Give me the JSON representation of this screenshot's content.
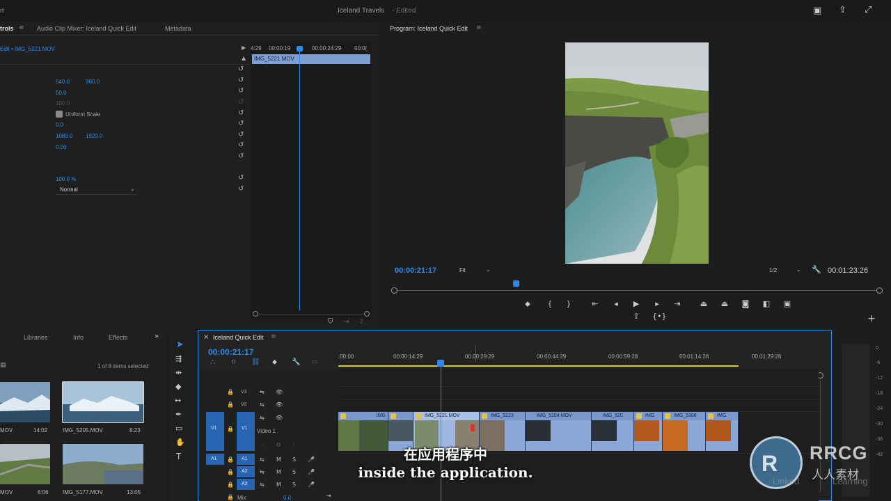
{
  "window": {
    "title": "Iceland Travels",
    "status": "- Edited",
    "left_fragment": "rt"
  },
  "effect_controls": {
    "tabs": [
      "trols",
      "Audio Clip Mixer: Iceland Quick Edit",
      "Metadata"
    ],
    "clip_path": "Edit • IMG_5221.MOV",
    "values": {
      "position_x": "540.0",
      "position_y": "960.0",
      "scale": "50.0",
      "scale_width": "100.0",
      "uniform_scale": "Uniform Scale",
      "rotation": "0.0",
      "anchor_x": "1080.0",
      "anchor_y": "1920.0",
      "anti_flicker": "0.00",
      "opacity": "100.0 %",
      "blend_mode": "Normal"
    },
    "mini_ruler": [
      "4:29",
      "00:00:19",
      "00:00:24:29",
      "00:0("
    ],
    "mini_clip": "IMG_5221.MOV"
  },
  "program_monitor": {
    "title": "Program: Iceland Quick Edit",
    "timecode": "00:00:21:17",
    "fit": "Fit",
    "resolution": "1/2",
    "duration": "00:01:23:26"
  },
  "project_panel": {
    "tabs": [
      "Libraries",
      "Info",
      "Effects"
    ],
    "selection": "1 of 8 items selected",
    "items": [
      {
        "name": "MOV",
        "duration": "14:02"
      },
      {
        "name": "IMG_5205.MOV",
        "duration": "8:23"
      },
      {
        "name": "MOV",
        "duration": "6:06"
      },
      {
        "name": "IMG_5177.MOV",
        "duration": "13:05"
      }
    ]
  },
  "timeline": {
    "title": "Iceland Quick Edit",
    "timecode": "00:00:21:17",
    "ruler": [
      ":00:00",
      "00:00:14:29",
      "00:00:29:29",
      "00:00:44:29",
      "00:00:59:28",
      "00:01:14:28",
      "00:01:29:28"
    ],
    "tracks": {
      "v3": "V3",
      "v2": "V2",
      "v1": "V1",
      "v1_src": "V1",
      "video1": "Video 1",
      "a1": "A1",
      "a1_src": "A1",
      "a2": "A2",
      "a3": "A3",
      "mix": "Mix",
      "mix_val": "0.0"
    },
    "clips": [
      "IMG",
      "IMG_5221.MOV",
      "IMG_5223",
      "IMG_5204.MOV",
      "IMG_520",
      "IMG",
      "IMG_5388",
      "IMG"
    ]
  },
  "meters": [
    "0",
    "-6",
    "-12",
    "-18",
    "-24",
    "-30",
    "-36",
    "-42"
  ],
  "subtitles": {
    "zh": "在应用程序中",
    "en": "inside the application."
  },
  "watermark": {
    "brand": "RRCG",
    "brand_sub": "人人素材",
    "linkedin": "Linked",
    "learning": "Learning"
  }
}
